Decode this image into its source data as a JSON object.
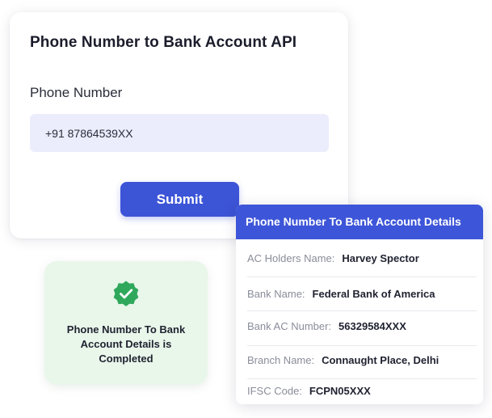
{
  "api_form": {
    "title": "Phone Number to Bank Account API",
    "field_label": "Phone Number",
    "phone_value": "+91 87864539XX",
    "submit_label": "Submit"
  },
  "success_toast": {
    "message": "Phone Number To Bank Account Details is Completed",
    "icon": "check-badge-icon",
    "icon_color": "#2fa85c"
  },
  "details": {
    "header": "Phone Number To Bank Account Details",
    "rows": [
      {
        "label": "AC Holders Name:",
        "value": "Harvey Spector"
      },
      {
        "label": "Bank Name:",
        "value": "Federal Bank of America"
      },
      {
        "label": "Bank AC Number:",
        "value": "56329584XXX"
      },
      {
        "label": "Branch Name:",
        "value": "Connaught Place, Delhi"
      },
      {
        "label": "IFSC Code:",
        "value": "FCPN05XXX"
      }
    ]
  },
  "colors": {
    "accent": "#3c54d6",
    "input_bg": "#ecedfc",
    "success_bg": "#e9f6ea"
  }
}
